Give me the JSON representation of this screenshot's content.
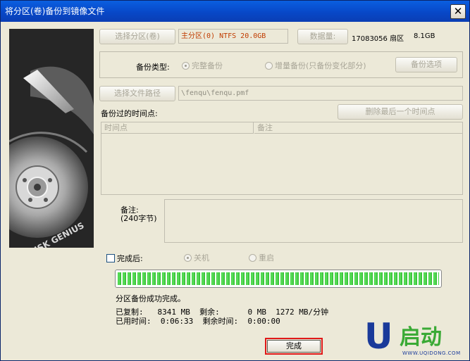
{
  "window": {
    "title": "将分区(卷)备份到镜像文件",
    "close_glyph": "✕"
  },
  "partition": {
    "select_label": "选择分区(卷)",
    "value": "主分区(0) NTFS 20.0GB",
    "data_label": "数据量:",
    "sectors": "17083056 扇区",
    "size": "8.1GB"
  },
  "backup_type": {
    "label": "备份类型:",
    "options": [
      {
        "label": "完整备份",
        "checked": true
      },
      {
        "label": "增量备份(只备份变化部分)",
        "checked": false
      }
    ],
    "options_button": "备份选项"
  },
  "file_path": {
    "select_label": "选择文件路径",
    "value": "\\fenqu\\fenqu.pmf"
  },
  "timepoints": {
    "label": "备份过的时间点:",
    "delete_button": "删除最后一个时间点",
    "columns": [
      "时间点",
      "备注"
    ]
  },
  "note": {
    "label": "备注:",
    "hint": "(240字节)"
  },
  "after_done": {
    "label": "完成后:",
    "options": [
      {
        "label": "关机",
        "checked": true
      },
      {
        "label": "重启",
        "checked": false
      }
    ]
  },
  "progress": {
    "percent": 100
  },
  "status": {
    "message": "分区备份成功完成。",
    "line1": "已复制:   8341 MB  剩余:      0 MB  1272 MB/分钟",
    "line2": "已用时间:  0:06:33  剩余时间:  0:00:00"
  },
  "finish_button": "完成",
  "logo": {
    "letter": "U",
    "name": "启动",
    "url": "WWW.UQIDONG.COM"
  },
  "art": {
    "text": "DISK GENIUS"
  },
  "colors": {
    "titlebar": "#0848c8",
    "partition_text": "#c03c00",
    "progress": "#3ed23e",
    "finish_highlight": "#e01818",
    "logo_green": "#3aaa35",
    "logo_blue": "#1a3a9a"
  }
}
